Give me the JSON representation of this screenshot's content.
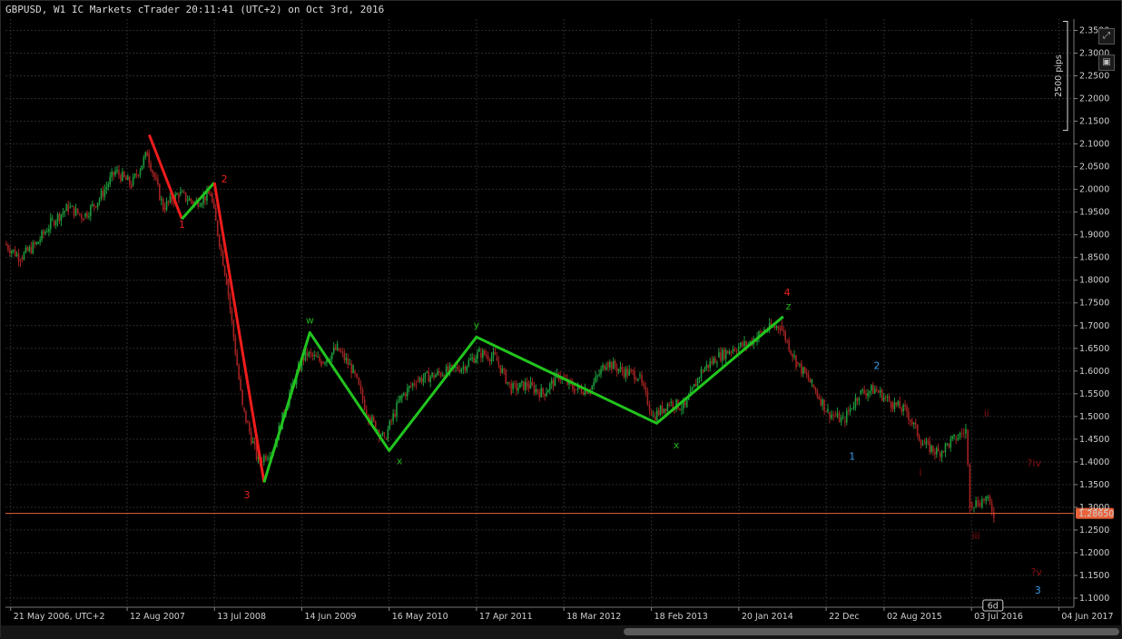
{
  "header": {
    "title": "GBPUSD, W1 IC Markets cTrader 20:11:41 (UTC+2) on Oct 3rd, 2016"
  },
  "toolbar": {
    "expand_icon": "expand-icon",
    "camera_icon": "camera-icon"
  },
  "colors": {
    "background": "#000000",
    "grid": "#2b2b2b",
    "bull_candle": "#1c9a3b",
    "bear_candle": "#a32222",
    "red_wave": "#ee1c1c",
    "green_wave": "#22c41e",
    "blue_label": "#3a9be8",
    "price_line": "#e8623a"
  },
  "chart_data": {
    "type": "line",
    "symbol": "GBPUSD",
    "timeframe": "W1",
    "y_tick_labels": [
      "2.3500",
      "2.3000",
      "2.2500",
      "2.2000",
      "2.1500",
      "2.1000",
      "2.0500",
      "2.0000",
      "1.9500",
      "1.9000",
      "1.8500",
      "1.8000",
      "1.7500",
      "1.7000",
      "1.6500",
      "1.6000",
      "1.5500",
      "1.5000",
      "1.4500",
      "1.4000",
      "1.3500",
      "1.3000",
      "1.2500",
      "1.2000",
      "1.1500",
      "1.1000"
    ],
    "ylim": [
      1.08,
      2.375
    ],
    "x_tick_labels": [
      "21 May 2006, UTC+2",
      "12 Aug 2007",
      "13 Jul 2008",
      "14 Jun 2009",
      "16 May 2010",
      "17 Apr 2011",
      "18 Mar 2012",
      "18 Feb 2013",
      "20 Jan 2014",
      "22 Dec",
      "02 Aug 2015",
      "03 Jul 2016",
      "04 Jun 2017"
    ],
    "x_tick_dates": [
      "2006-05-21",
      "2007-08-12",
      "2008-07-13",
      "2009-06-14",
      "2010-05-16",
      "2011-04-17",
      "2012-03-18",
      "2013-02-18",
      "2014-01-20",
      "2014-12-22",
      "2015-08-02",
      "2016-07-03",
      "2017-06-04"
    ],
    "xlim": [
      "2006-05-01",
      "2017-08-01"
    ],
    "current_price": "1.28650",
    "current_price_value": 1.2865,
    "time_tooltip": "6d",
    "ruler_label": "2500 pips",
    "ruler_range": [
      2.13,
      2.37
    ],
    "price_series": [
      [
        "2006-05-01",
        1.88
      ],
      [
        "2006-07-01",
        1.85
      ],
      [
        "2006-09-01",
        1.88
      ],
      [
        "2006-11-01",
        1.93
      ],
      [
        "2007-01-01",
        1.96
      ],
      [
        "2007-03-01",
        1.94
      ],
      [
        "2007-05-01",
        1.98
      ],
      [
        "2007-07-01",
        2.04
      ],
      [
        "2007-09-01",
        2.01
      ],
      [
        "2007-11-01",
        2.08
      ],
      [
        "2008-01-01",
        1.96
      ],
      [
        "2008-03-01",
        1.99
      ],
      [
        "2008-05-01",
        1.97
      ],
      [
        "2008-07-01",
        1.99
      ],
      [
        "2008-09-01",
        1.8
      ],
      [
        "2008-11-01",
        1.52
      ],
      [
        "2009-01-01",
        1.4
      ],
      [
        "2009-03-01",
        1.43
      ],
      [
        "2009-05-01",
        1.55
      ],
      [
        "2009-07-01",
        1.64
      ],
      [
        "2009-09-01",
        1.62
      ],
      [
        "2009-11-01",
        1.65
      ],
      [
        "2010-01-01",
        1.6
      ],
      [
        "2010-03-01",
        1.5
      ],
      [
        "2010-05-01",
        1.45
      ],
      [
        "2010-07-01",
        1.54
      ],
      [
        "2010-09-01",
        1.58
      ],
      [
        "2010-11-01",
        1.59
      ],
      [
        "2011-01-01",
        1.6
      ],
      [
        "2011-03-01",
        1.61
      ],
      [
        "2011-05-01",
        1.64
      ],
      [
        "2011-07-01",
        1.63
      ],
      [
        "2011-09-01",
        1.56
      ],
      [
        "2011-11-01",
        1.57
      ],
      [
        "2012-01-01",
        1.55
      ],
      [
        "2012-03-01",
        1.59
      ],
      [
        "2012-05-01",
        1.56
      ],
      [
        "2012-07-01",
        1.56
      ],
      [
        "2012-09-01",
        1.62
      ],
      [
        "2012-11-01",
        1.6
      ],
      [
        "2013-01-01",
        1.59
      ],
      [
        "2013-03-01",
        1.5
      ],
      [
        "2013-05-01",
        1.53
      ],
      [
        "2013-07-01",
        1.52
      ],
      [
        "2013-09-01",
        1.6
      ],
      [
        "2013-11-01",
        1.63
      ],
      [
        "2014-01-01",
        1.65
      ],
      [
        "2014-03-01",
        1.66
      ],
      [
        "2014-05-01",
        1.69
      ],
      [
        "2014-07-01",
        1.7
      ],
      [
        "2014-09-01",
        1.62
      ],
      [
        "2014-11-01",
        1.57
      ],
      [
        "2015-01-01",
        1.51
      ],
      [
        "2015-03-01",
        1.49
      ],
      [
        "2015-05-01",
        1.55
      ],
      [
        "2015-07-01",
        1.56
      ],
      [
        "2015-09-01",
        1.53
      ],
      [
        "2015-11-01",
        1.51
      ],
      [
        "2016-01-01",
        1.44
      ],
      [
        "2016-03-01",
        1.42
      ],
      [
        "2016-05-01",
        1.45
      ],
      [
        "2016-06-15",
        1.47
      ],
      [
        "2016-07-01",
        1.31
      ],
      [
        "2016-08-01",
        1.31
      ],
      [
        "2016-09-01",
        1.32
      ],
      [
        "2016-10-01",
        1.2865
      ]
    ],
    "wave_lines": [
      {
        "color": "red",
        "points": [
          [
            "2007-11-05",
            2.12
          ],
          [
            "2008-03-10",
            1.935
          ]
        ]
      },
      {
        "color": "green",
        "points": [
          [
            "2008-03-10",
            1.935
          ],
          [
            "2008-07-13",
            2.015
          ]
        ]
      },
      {
        "color": "red",
        "points": [
          [
            "2008-07-13",
            2.015
          ],
          [
            "2009-01-20",
            1.355
          ]
        ]
      },
      {
        "color": "green",
        "points": [
          [
            "2009-01-20",
            1.355
          ],
          [
            "2009-07-15",
            1.685
          ],
          [
            "2010-05-16",
            1.425
          ],
          [
            "2011-04-17",
            1.675
          ],
          [
            "2013-03-10",
            1.485
          ],
          [
            "2014-07-10",
            1.72
          ]
        ]
      }
    ],
    "wave_labels": [
      {
        "text": "1",
        "color": "red",
        "x": "2008-03-10",
        "y": 1.915
      },
      {
        "text": "2",
        "color": "red",
        "x": "2008-08-20",
        "y": 2.015
      },
      {
        "text": "3",
        "color": "red",
        "x": "2008-11-15",
        "y": 1.32
      },
      {
        "text": "4",
        "color": "red",
        "x": "2014-07-25",
        "y": 1.765
      },
      {
        "text": "w",
        "color": "green",
        "x": "2009-07-15",
        "y": 1.705
      },
      {
        "text": "x",
        "color": "green",
        "x": "2010-06-25",
        "y": 1.395
      },
      {
        "text": "y",
        "color": "green",
        "x": "2011-04-17",
        "y": 1.695
      },
      {
        "text": "x",
        "color": "green",
        "x": "2013-05-25",
        "y": 1.43
      },
      {
        "text": "z",
        "color": "green",
        "x": "2014-07-30",
        "y": 1.735
      },
      {
        "text": "1",
        "color": "blue",
        "x": "2015-04-01",
        "y": 1.405
      },
      {
        "text": "2",
        "color": "blue",
        "x": "2015-07-05",
        "y": 1.605
      },
      {
        "text": "3",
        "color": "blue",
        "x": "2017-03-15",
        "y": 1.11
      },
      {
        "text": "ii",
        "color": "dark-red",
        "x": "2016-08-30",
        "y": 1.5
      },
      {
        "text": "i",
        "color": "dark-red",
        "x": "2015-12-20",
        "y": 1.37
      },
      {
        "text": "iii",
        "color": "dark-red",
        "x": "2016-07-20",
        "y": 1.23
      },
      {
        "text": "?iv",
        "color": "dark-red",
        "x": "2017-03-01",
        "y": 1.39
      },
      {
        "text": "?v",
        "color": "dark-red",
        "x": "2017-03-10",
        "y": 1.15
      }
    ]
  }
}
